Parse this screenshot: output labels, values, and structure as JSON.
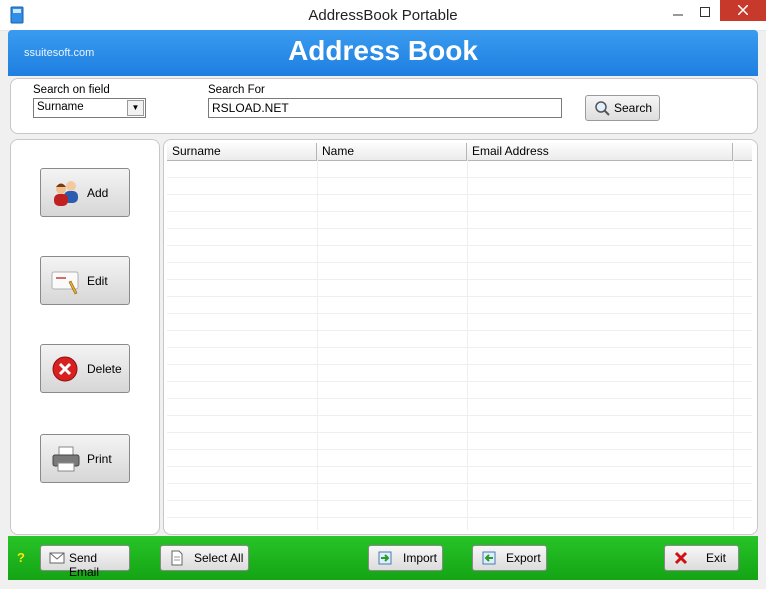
{
  "window": {
    "title": "AddressBook Portable"
  },
  "header": {
    "brand": "ssuitesoft.com",
    "title": "Address Book"
  },
  "search": {
    "field_label": "Search on field",
    "field_value": "Surname",
    "for_label": "Search For",
    "for_value": "RSLOAD.NET",
    "button_label": "Search"
  },
  "sidebar": {
    "items": [
      {
        "label": "Add",
        "icon": "users-icon"
      },
      {
        "label": "Edit",
        "icon": "edit-card-icon"
      },
      {
        "label": "Delete",
        "icon": "delete-icon"
      },
      {
        "label": "Print",
        "icon": "printer-icon"
      }
    ]
  },
  "table": {
    "columns": [
      "Surname",
      "Name",
      "Email Address"
    ],
    "rows": []
  },
  "bottom": {
    "help": "?",
    "send_email": "Send Email",
    "select_all": "Select All",
    "import": "Import",
    "export": "Export",
    "exit": "Exit"
  },
  "colors": {
    "header_blue": "#1e7fe0",
    "bottom_green": "#14a414",
    "close_red": "#c7392b"
  }
}
